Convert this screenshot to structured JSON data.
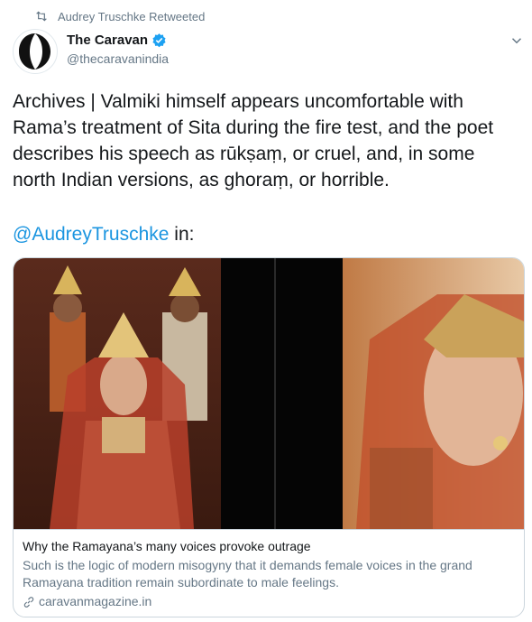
{
  "retweet": {
    "text": "Audrey Truschke Retweeted",
    "icon": "retweet-icon"
  },
  "author": {
    "name": "The Caravan",
    "handle": "@thecaravanindia",
    "verified_color": "#1da1f2"
  },
  "tweet": {
    "text": "Archives | Valmiki himself appears uncomfortable with Rama’s treatment of Sita during the fire test, and the poet describes his speech as rūkṣaṃ, or cruel, and, in some north Indian versions, as ghoraṃ, or horrible.",
    "mention": "@AudreyTruschke",
    "mention_suffix": " in:"
  },
  "card": {
    "title": "Why the Ramayana’s many voices provoke outrage",
    "description": "Such is the logic of modern misogyny that it demands female voices in the grand Ramayana tradition remain subordinate to male feelings.",
    "domain": "caravanmagazine.in"
  },
  "colors": {
    "link": "#1b95e0",
    "secondary_text": "#657786",
    "border": "#ccd6dd"
  }
}
